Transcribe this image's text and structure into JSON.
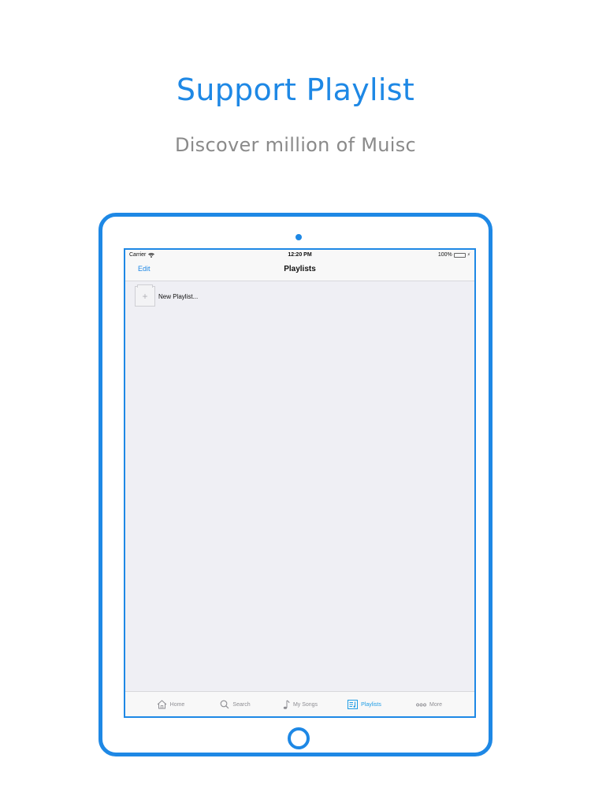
{
  "promo": {
    "headline": "Support Playlist",
    "subline": "Discover million of Muisc"
  },
  "status_bar": {
    "carrier": "Carrier",
    "time": "12:20 PM",
    "battery": "100%"
  },
  "nav": {
    "edit_label": "Edit",
    "title": "Playlists"
  },
  "list": {
    "new_playlist_label": "New Playlist..."
  },
  "tabbar": {
    "tabs": [
      {
        "label": "Home",
        "icon": "home-icon"
      },
      {
        "label": "Search",
        "icon": "search-icon"
      },
      {
        "label": "My Songs",
        "icon": "music-note-icon"
      },
      {
        "label": "Playlists",
        "icon": "playlist-icon",
        "active": true
      },
      {
        "label": "More",
        "icon": "more-icon"
      }
    ]
  },
  "colors": {
    "accent": "#1E88E5",
    "tab_active": "#1E9CE5",
    "subtitle_gray": "#8a8a8a",
    "screen_bg": "#efeff4"
  }
}
